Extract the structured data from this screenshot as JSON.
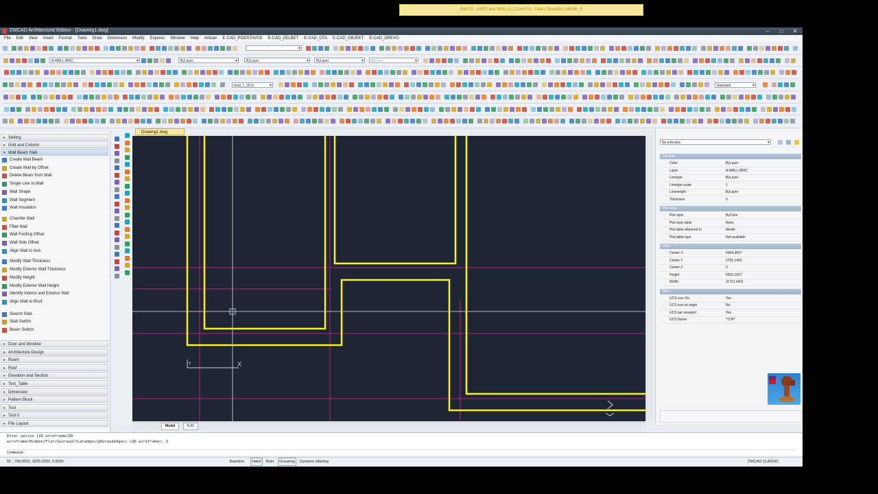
{
  "window": {
    "title": "ZWCAD Architectural Edition - [Drawing1.dwg]",
    "banner": "Part 01 - AXES and WALLS | Czech 01 - Dale | Beautiful | Martin_S",
    "min_glyph": "–",
    "max_glyph": "□",
    "close_glyph": "✕"
  },
  "menu": [
    "File",
    "Edit",
    "View",
    "Insert",
    "Format",
    "Tools",
    "Draw",
    "Dimension",
    "Modify",
    "Express",
    "Window",
    "Help",
    "Artisan",
    "E-CAD_PODSTAVCE",
    "E-CAD_ZELBET",
    "E-CAD_OTA",
    "E-CAD_OBJEKT",
    "E-CAD_DREVO"
  ],
  "toolbars": {
    "layer_value": "A-WALL-BRIC",
    "color_value": "ByLayer",
    "linetype_value": "ByLayer",
    "lineweight_value": "ByLayer",
    "plotstyle_value": "ByColor",
    "dimstyle_value": "Standard",
    "scale_value": "mod_1_25 (v"
  },
  "left_panel": {
    "sections_top": [
      {
        "label": "Setting",
        "open": false
      },
      {
        "label": "Grid and Column",
        "open": false
      },
      {
        "label": "Wall Beam Slab",
        "open": true
      }
    ],
    "items": [
      "Create Wall Beam",
      "Create Wall by Offset",
      "Delete Beam from Wall",
      "Single Line to Wall",
      "Wall Shape",
      "Wall Segment",
      "Wall Insulation",
      "Chamfer Wall",
      "Fillet Wall",
      "Wall Footing Offset",
      "Wall Side Offset",
      "Align Wall to Axis",
      "Modify Wall Thickness",
      "Modify Exterior Wall Thickness",
      "Modify Height",
      "Modify Exterior Wall Height",
      "Identify Interior and Exterior Wall",
      "Align Wall to Roof",
      "Search Slab",
      "Slab Switch",
      "Beam Switch"
    ],
    "sections_bottom": [
      "Door and Window",
      "Architecture Design",
      "Room",
      "Roof",
      "Elevation and Section",
      "Text_Table",
      "Dimension",
      "Pattern Block",
      "Tool",
      "Tool II",
      "File Layout"
    ]
  },
  "drawing": {
    "tab": "Drawing1.dwg",
    "layout_tabs": [
      "Model",
      "6-01"
    ],
    "ucs_x_label": "X",
    "ucs_y_label": "Y"
  },
  "properties": {
    "selection": "No selection",
    "groups": [
      {
        "title": "General",
        "rows": [
          [
            "Color",
            "ByLayer"
          ],
          [
            "Layer",
            "A-WALL-BRIC"
          ],
          [
            "Linetype",
            "ByLayer"
          ],
          [
            "Linetype scale",
            "1"
          ],
          [
            "Lineweight",
            "ByLayer"
          ],
          [
            "Thickness",
            "0"
          ]
        ]
      },
      {
        "title": "Plot style",
        "rows": [
          [
            "Plot style",
            "ByColor"
          ],
          [
            "Plot style table",
            "None"
          ],
          [
            "Plot table attached to",
            "Model"
          ],
          [
            "Plot table type",
            "Not available"
          ]
        ]
      },
      {
        "title": "View",
        "rows": [
          [
            "Center X",
            "4364.3657"
          ],
          [
            "Center Y",
            "2795.1481"
          ],
          [
            "Center Z",
            "0"
          ],
          [
            "Height",
            "6553.1067"
          ],
          [
            "Width",
            "11721.9421"
          ]
        ]
      },
      {
        "title": "Misc",
        "rows": [
          [
            "UCS icon On",
            "Yes"
          ],
          [
            "UCS icon at origin",
            "No"
          ],
          [
            "UCS per viewport",
            "Yes"
          ],
          [
            "UCS Name",
            "*TOP*"
          ]
        ]
      }
    ]
  },
  "command": {
    "lines": [
      "Enter option [2D wireframe/3D",
      "wireframe/Hidden/Flat/Gouraud/fLatedges/gOuraudedges] <2D wireframe>: 3",
      "Command:"
    ]
  },
  "status": {
    "coords": "50 , 790.0002, 3025.0250, 0.0000",
    "toggles": [
      "Baseline",
      "Hatch",
      "Bold",
      "Grouping",
      "Dynamic labeling"
    ],
    "profile": "ZWCAD CLASSIC"
  },
  "colors": {
    "canvas": "#1f2633",
    "wall": "#ffef1a",
    "axis": "#c21f8a",
    "crosshair": "#b9bec6"
  }
}
